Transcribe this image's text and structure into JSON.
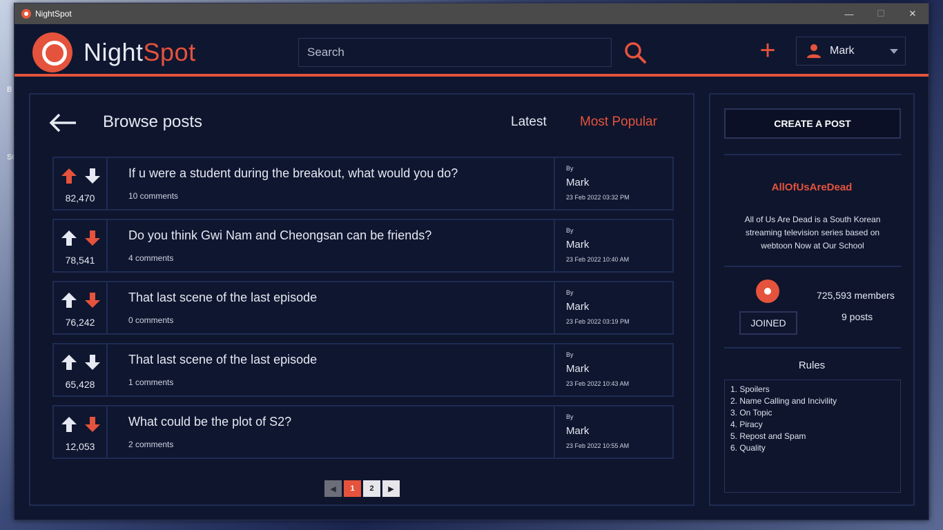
{
  "desktop": {
    "label_b": "B",
    "label_sc": "SC"
  },
  "window": {
    "title": "NightSpot"
  },
  "header": {
    "brand_part1": "Night",
    "brand_part2": "Spot",
    "search_placeholder": "Search",
    "user_name": "Mark"
  },
  "main": {
    "title": "Browse posts",
    "tabs": [
      {
        "label": "Latest",
        "active": false
      },
      {
        "label": "Most Popular",
        "active": true
      }
    ],
    "posts": [
      {
        "score": "82,470",
        "title": "If u were a student during the breakout, what would you do?",
        "comments": "10 comments",
        "by": "By",
        "author": "Mark",
        "date": "23 Feb 2022 03:32 PM",
        "vote": "up"
      },
      {
        "score": "78,541",
        "title": "Do you think Gwi Nam and Cheongsan can be friends?",
        "comments": "4 comments",
        "by": "By",
        "author": "Mark",
        "date": "23 Feb 2022 10:40 AM",
        "vote": "down"
      },
      {
        "score": "76,242",
        "title": "That last scene of the last episode",
        "comments": "0 comments",
        "by": "By",
        "author": "Mark",
        "date": "23 Feb 2022 03:19 PM",
        "vote": "down"
      },
      {
        "score": "65,428",
        "title": "That last scene of the last episode",
        "comments": "1 comments",
        "by": "By",
        "author": "Mark",
        "date": "23 Feb 2022 10:43 AM",
        "vote": "none"
      },
      {
        "score": "12,053",
        "title": "What could be the plot of S2?",
        "comments": "2 comments",
        "by": "By",
        "author": "Mark",
        "date": "23 Feb 2022 10:55 AM",
        "vote": "down"
      }
    ],
    "pagination": {
      "prev": "◀",
      "pages": [
        "1",
        "2"
      ],
      "current": "1",
      "next": "▶"
    }
  },
  "sidebar": {
    "create_label": "CREATE A POST",
    "community_name": "AllOfUsAreDead",
    "description": "All of Us Are Dead is a South Korean streaming television series based on webtoon Now at Our School",
    "joined_label": "JOINED",
    "members": "725,593 members",
    "posts_count": "9 posts",
    "rules_title": "Rules",
    "rules": [
      "1. Spoilers",
      "2. Name Calling and Incivility",
      "3. On Topic",
      "4. Piracy",
      "5. Repost and Spam",
      "6. Quality"
    ]
  },
  "colors": {
    "accent": "#e5533c",
    "background": "#0f1630",
    "border": "#1e2c54",
    "text": "#e6e9f2"
  },
  "icons": {
    "app": "nightspot-logo-icon",
    "search": "search-icon",
    "add": "plus-icon",
    "user": "user-icon",
    "back": "arrow-left-icon",
    "upvote": "arrow-up-icon",
    "downvote": "arrow-down-icon"
  }
}
